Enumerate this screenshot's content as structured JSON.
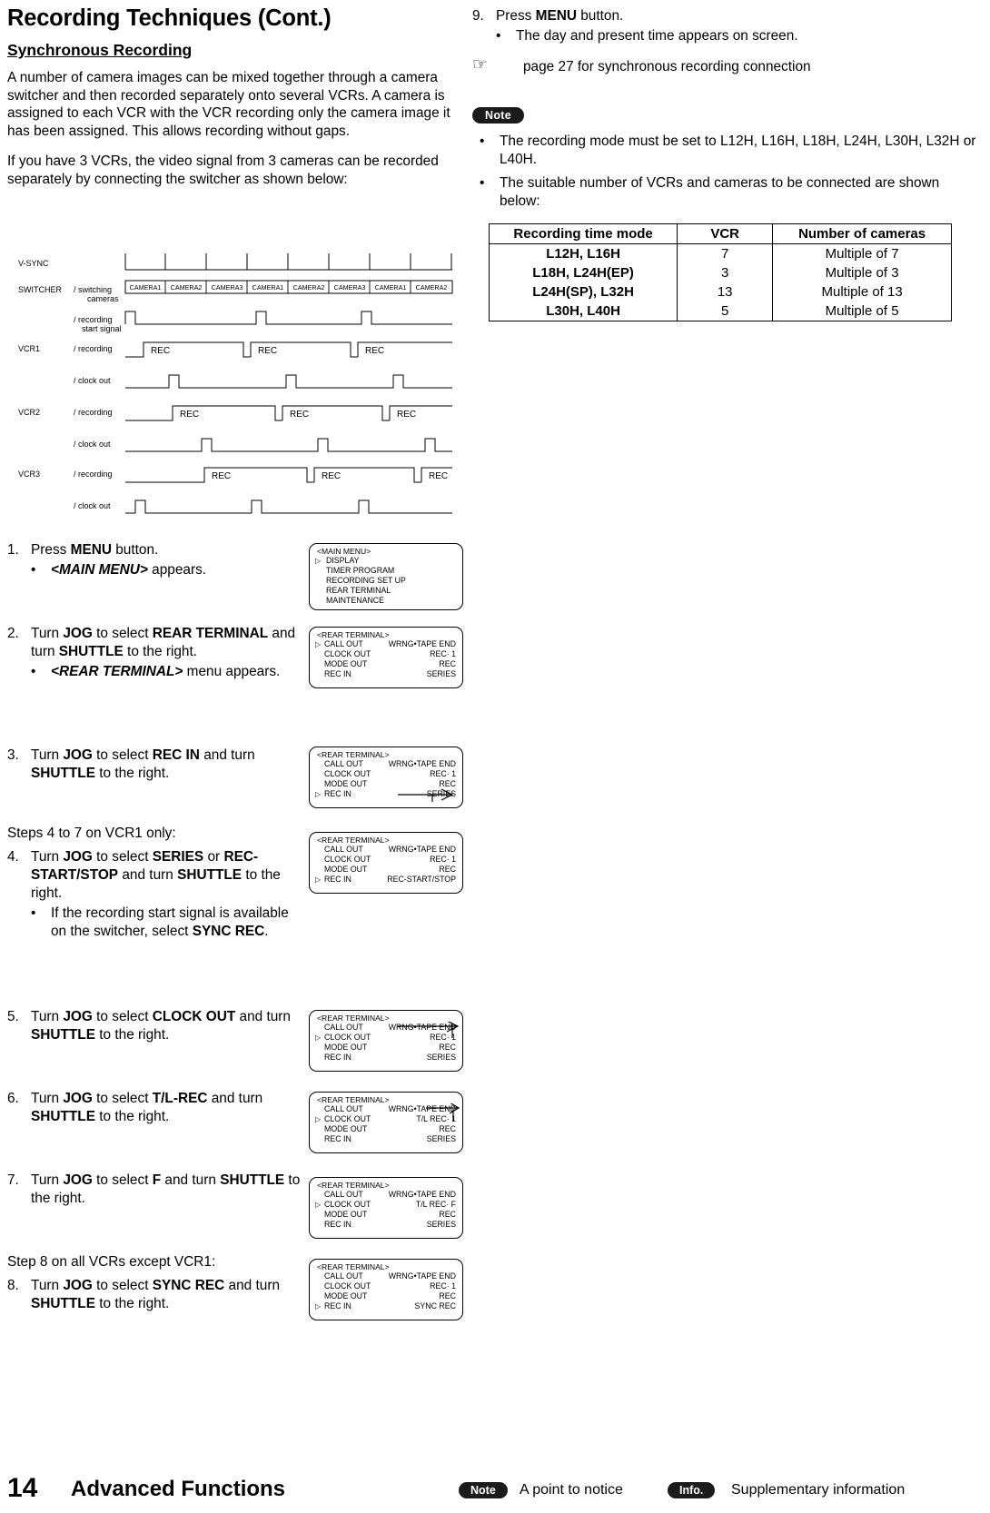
{
  "page": {
    "number": "14",
    "section": "Advanced Functions",
    "footer": {
      "note_badge": "Note",
      "note_text": "A point to notice",
      "info_badge": "Info.",
      "info_text": "Supplementary information"
    }
  },
  "left": {
    "title": "Recording Techniques (Cont.)",
    "subtitle": "Synchronous Recording",
    "para1": "A number of camera images can be mixed together through a camera switcher and then recorded separately onto several VCRs.  A camera is assigned to each VCR with the VCR recording only the camera image it has been assigned.  This allows recording without gaps.",
    "para2": "If you have 3 VCRs, the video signal from 3 cameras can be recorded separately by connecting the switcher as shown below:",
    "steps": [
      {
        "num": "1.",
        "text_html": "Press <b>MENU</b> button.",
        "bullets": [
          "<b><i>&lt;MAIN MENU&gt;</i></b> appears."
        ]
      },
      {
        "num": "2.",
        "text_html": "Turn <b>JOG</b> to select <b>REAR TERMINAL</b> and turn <b>SHUTTLE</b> to the right.",
        "bullets": [
          "<b><i>&lt;REAR TERMINAL&gt;</i></b> menu appears."
        ]
      },
      {
        "num": "3.",
        "text_html": "Turn <b>JOG</b> to select <b>REC IN</b> and turn <b>SHUTTLE</b> to the right.",
        "bullets": []
      },
      {
        "num": "4.",
        "text_html": "Turn <b>JOG</b> to select <b>SERIES</b> or <b>REC-START/STOP</b> and turn <b>SHUTTLE</b> to the right.",
        "bullets": [
          "If the recording start signal is available on the switcher, select <b>SYNC REC</b>."
        ]
      },
      {
        "num": "5.",
        "text_html": "Turn <b>JOG</b> to select <b>CLOCK OUT</b> and turn <b>SHUTTLE</b> to the right.",
        "bullets": []
      },
      {
        "num": "6.",
        "text_html": "Turn <b>JOG</b> to select <b>T/L-REC</b> and turn <b>SHUTTLE</b> to the right.",
        "bullets": []
      },
      {
        "num": "7.",
        "text_html": "Turn <b>JOG</b> to select <b>F</b> and turn <b>SHUTTLE</b> to the right.",
        "bullets": []
      },
      {
        "num": "8.",
        "text_html": "Turn <b>JOG</b> to select <b>SYNC REC</b> and turn <b>SHUTTLE</b> to the right.",
        "bullets": []
      }
    ],
    "note_steps47": "Steps 4 to 7 on VCR1 only:",
    "note_step8": "Step 8 on all VCRs except VCR1:"
  },
  "diagram": {
    "labels": {
      "vsync": "V-SYNC",
      "switcher": "SWITCHER",
      "switcher_sub": "/ switching cameras",
      "rec_start": "/ recording start signal",
      "vcr1": "VCR1",
      "vcr2": "VCR2",
      "vcr3": "VCR3",
      "recording": "/ recording",
      "clock_out": "/ clock out",
      "rec": "REC"
    },
    "camera_sequence": [
      "CAMERA1",
      "CAMERA2",
      "CAMERA3",
      "CAMERA1",
      "CAMERA2",
      "CAMERA3",
      "CAMERA1",
      "CAMERA2"
    ]
  },
  "menus": {
    "main": {
      "title": "<MAIN MENU>",
      "items": [
        "DISPLAY",
        "TIMER PROGRAM",
        "RECORDING SET UP",
        "REAR TERMINAL",
        "MAINTENANCE"
      ],
      "cursor_index": 0
    },
    "rear_step2": {
      "title": "<REAR TERMINAL>",
      "rows": [
        {
          "left": "CALL OUT",
          "right": "WRNG•TAPE END"
        },
        {
          "left": "CLOCK OUT",
          "right": "REC· 1"
        },
        {
          "left": "MODE OUT",
          "right": "REC"
        },
        {
          "left": "REC IN",
          "right": "SERIES"
        }
      ],
      "cursor_index": 0
    },
    "rear_step3": {
      "title": "<REAR TERMINAL>",
      "rows": [
        {
          "left": "CALL OUT",
          "right": "WRNG•TAPE END"
        },
        {
          "left": "CLOCK OUT",
          "right": "REC· 1"
        },
        {
          "left": "MODE OUT",
          "right": "REC"
        },
        {
          "left": "REC IN",
          "right": "SERIES"
        }
      ],
      "cursor_index": 3
    },
    "rear_step4": {
      "title": "<REAR TERMINAL>",
      "rows": [
        {
          "left": "CALL OUT",
          "right": "WRNG•TAPE END"
        },
        {
          "left": "CLOCK OUT",
          "right": "REC· 1"
        },
        {
          "left": "MODE OUT",
          "right": "REC"
        },
        {
          "left": "REC IN",
          "right": "REC-START/STOP"
        }
      ],
      "cursor_index": 3
    },
    "rear_step5": {
      "title": "<REAR TERMINAL>",
      "rows": [
        {
          "left": "CALL OUT",
          "right": "WRNG•TAPE END"
        },
        {
          "left": "CLOCK OUT",
          "right": "REC· 1"
        },
        {
          "left": "MODE OUT",
          "right": "REC"
        },
        {
          "left": "REC IN",
          "right": "SERIES"
        }
      ],
      "cursor_index": 1
    },
    "rear_step6": {
      "title": "<REAR TERMINAL>",
      "rows": [
        {
          "left": "CALL OUT",
          "right": "WRNG•TAPE END"
        },
        {
          "left": "CLOCK OUT",
          "right": "T/L REC· 1"
        },
        {
          "left": "MODE OUT",
          "right": "REC"
        },
        {
          "left": "REC IN",
          "right": "SERIES"
        }
      ],
      "cursor_index": 1
    },
    "rear_step7": {
      "title": "<REAR TERMINAL>",
      "rows": [
        {
          "left": "CALL OUT",
          "right": "WRNG•TAPE END"
        },
        {
          "left": "CLOCK OUT",
          "right": "T/L REC· F"
        },
        {
          "left": "MODE OUT",
          "right": "REC"
        },
        {
          "left": "REC IN",
          "right": "SERIES"
        }
      ],
      "cursor_index": 1
    },
    "rear_step8": {
      "title": "<REAR TERMINAL>",
      "rows": [
        {
          "left": "CALL OUT",
          "right": "WRNG•TAPE END"
        },
        {
          "left": "CLOCK OUT",
          "right": "REC· 1"
        },
        {
          "left": "MODE OUT",
          "right": "REC"
        },
        {
          "left": "REC IN",
          "right": "SYNC REC"
        }
      ],
      "cursor_index": 3
    }
  },
  "right": {
    "step9": {
      "num": "9.",
      "text_html": "Press <b>MENU</b> button.",
      "bullet": "The day and present time appears on screen."
    },
    "reference": "page 27 for synchronous recording connection",
    "note_badge": "Note",
    "notes": [
      "The recording mode must be set to L12H, L16H, L18H, L24H, L30H, L32H or L40H.",
      "The suitable number of VCRs and cameras to be connected are shown below:"
    ],
    "table": {
      "headers": [
        "Recording time mode",
        "VCR",
        "Number of cameras"
      ],
      "rows": [
        [
          "L12H, L16H",
          "7",
          "Multiple of 7"
        ],
        [
          "L18H, L24H(EP)",
          "3",
          "Multiple of 3"
        ],
        [
          "L24H(SP), L32H",
          "13",
          "Multiple of 13"
        ],
        [
          "L30H, L40H",
          "5",
          "Multiple of 5"
        ]
      ]
    }
  }
}
